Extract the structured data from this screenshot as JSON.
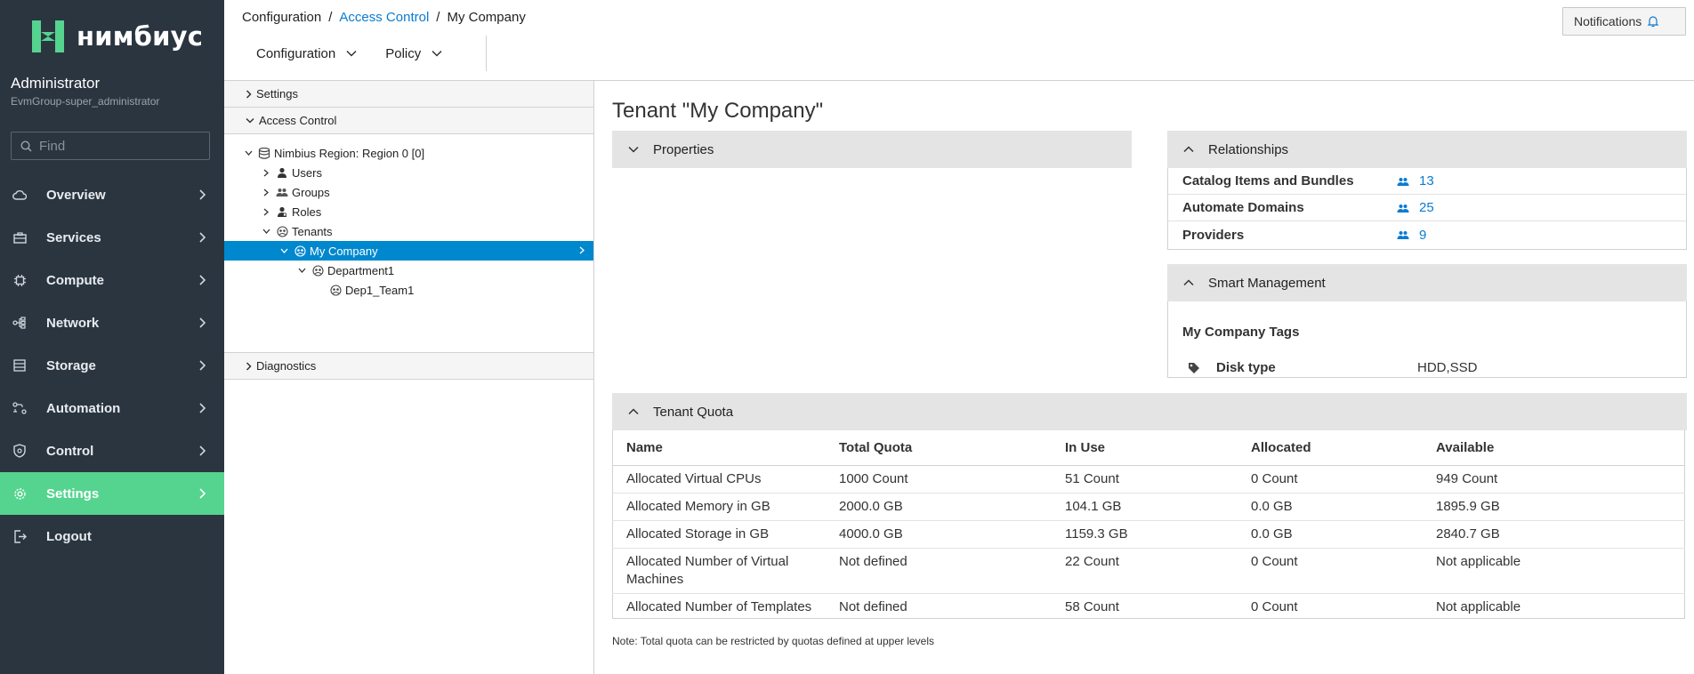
{
  "app": {
    "logo_text": "нимбиус",
    "user_name": "Administrator",
    "user_group": "EvmGroup-super_administrator",
    "find_placeholder": "Find"
  },
  "colors": {
    "sidebar_bg": "#2b3540",
    "active_nav": "#55d48f",
    "link": "#0b7bd1",
    "tree_selected": "#0088ce",
    "logo_accent": "#55d48f"
  },
  "nav": {
    "items": [
      {
        "label": "Overview",
        "icon": "cloud-icon"
      },
      {
        "label": "Services",
        "icon": "briefcase-icon"
      },
      {
        "label": "Compute",
        "icon": "chip-icon"
      },
      {
        "label": "Network",
        "icon": "network-icon"
      },
      {
        "label": "Storage",
        "icon": "database-icon"
      },
      {
        "label": "Automation",
        "icon": "automation-icon"
      },
      {
        "label": "Control",
        "icon": "shield-icon"
      },
      {
        "label": "Settings",
        "icon": "gear-icon",
        "active": true
      },
      {
        "label": "Logout",
        "icon": "logout-icon"
      }
    ]
  },
  "breadcrumb": {
    "items": [
      "Configuration",
      "Access Control",
      "My Company"
    ]
  },
  "toolbar": {
    "configuration_label": "Configuration",
    "policy_label": "Policy",
    "notifications_label": "Notifications"
  },
  "accordion": {
    "settings_label": "Settings",
    "access_control_label": "Access Control",
    "diagnostics_label": "Diagnostics"
  },
  "tree": {
    "nodes": [
      {
        "label": "Nimbius Region: Region 0 [0]",
        "depth": 0,
        "toggle": "expanded",
        "icon": "region-icon"
      },
      {
        "label": "Users",
        "depth": 1,
        "toggle": "collapsed",
        "icon": "user-icon"
      },
      {
        "label": "Groups",
        "depth": 1,
        "toggle": "collapsed",
        "icon": "group-icon"
      },
      {
        "label": "Roles",
        "depth": 1,
        "toggle": "collapsed",
        "icon": "role-icon"
      },
      {
        "label": "Tenants",
        "depth": 1,
        "toggle": "expanded",
        "icon": "tenant-icon"
      },
      {
        "label": "My Company",
        "depth": 2,
        "toggle": "expanded",
        "icon": "tenant-icon",
        "selected": true
      },
      {
        "label": "Department1",
        "depth": 3,
        "toggle": "expanded",
        "icon": "tenant-icon"
      },
      {
        "label": "Dep1_Team1",
        "depth": 4,
        "toggle": "none",
        "icon": "tenant-icon"
      }
    ]
  },
  "main": {
    "title": "Tenant \"My Company\"",
    "properties_label": "Properties",
    "relationships": {
      "label": "Relationships",
      "rows": [
        {
          "label": "Catalog Items and Bundles",
          "value": "13"
        },
        {
          "label": "Automate Domains",
          "value": "25"
        },
        {
          "label": "Providers",
          "value": "9"
        }
      ]
    },
    "smart_management": {
      "label": "Smart Management",
      "tags_title": "My Company Tags",
      "tag_label": "Disk type",
      "tag_value": "HDD,SSD"
    },
    "quota": {
      "label": "Tenant Quota",
      "columns": [
        "Name",
        "Total Quota",
        "In Use",
        "Allocated",
        "Available"
      ],
      "rows": [
        [
          "Allocated Virtual CPUs",
          "1000 Count",
          "51 Count",
          "0 Count",
          "949 Count"
        ],
        [
          "Allocated Memory in GB",
          "2000.0 GB",
          "104.1 GB",
          "0.0 GB",
          "1895.9 GB"
        ],
        [
          "Allocated Storage in GB",
          "4000.0 GB",
          "1159.3 GB",
          "0.0 GB",
          "2840.7 GB"
        ],
        [
          "Allocated Number of Virtual Machines",
          "Not defined",
          "22 Count",
          "0 Count",
          "Not applicable"
        ],
        [
          "Allocated Number of Templates",
          "Not defined",
          "58 Count",
          "0 Count",
          "Not applicable"
        ]
      ],
      "note": "Note: Total quota can be restricted by quotas defined at upper levels"
    }
  }
}
